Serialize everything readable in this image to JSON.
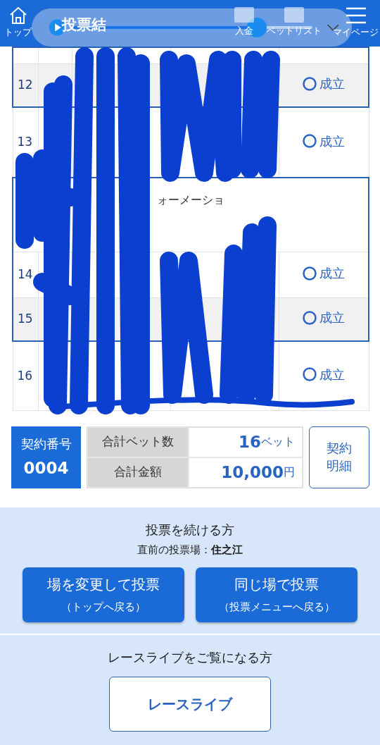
{
  "header": {
    "title": "投票結",
    "nav": [
      {
        "kind": "home",
        "label": "トップ"
      },
      {
        "kind": "deposit",
        "label": "入金"
      },
      {
        "kind": "list",
        "label": "ベットリスト"
      },
      {
        "kind": "menu",
        "label": "マイページ"
      }
    ]
  },
  "player": {
    "level": 0.77
  },
  "bets": [
    {
      "kind": "bet",
      "highlighted": true
    },
    {
      "kind": "bet",
      "no": "12",
      "status": "成立",
      "highlighted": true
    },
    {
      "kind": "bet",
      "no": "13",
      "status": "成立",
      "highlighted": false
    },
    {
      "kind": "info",
      "text": "ォーメーショ",
      "highlighted": true
    },
    {
      "kind": "bet",
      "no": "14",
      "status": "成立",
      "highlighted": true
    },
    {
      "kind": "bet",
      "no": "15",
      "status": "成立",
      "highlighted": true
    },
    {
      "kind": "bet",
      "no": "16",
      "status": "成立",
      "highlighted": false
    }
  ],
  "summary": {
    "contract_label": "契約番号",
    "contract_no": "0004",
    "rows": [
      {
        "label": "合計ベット数",
        "value": "16",
        "unit": "ベット"
      },
      {
        "label": "合計金額",
        "value": "10,000",
        "unit": "円"
      }
    ],
    "detail_button": "契約明細"
  },
  "continue": {
    "heading": "投票を続ける方",
    "last_venue": "直前の投票場：**住之江**",
    "buttons": [
      {
        "title": "場を変更して投票",
        "sub": "（トップへ戻る）"
      },
      {
        "title": "同じ場で投票",
        "sub": "（投票メニューへ戻る）"
      }
    ]
  },
  "live": {
    "heading": "レースライブをご覧になる方",
    "button": "レースライブ"
  }
}
